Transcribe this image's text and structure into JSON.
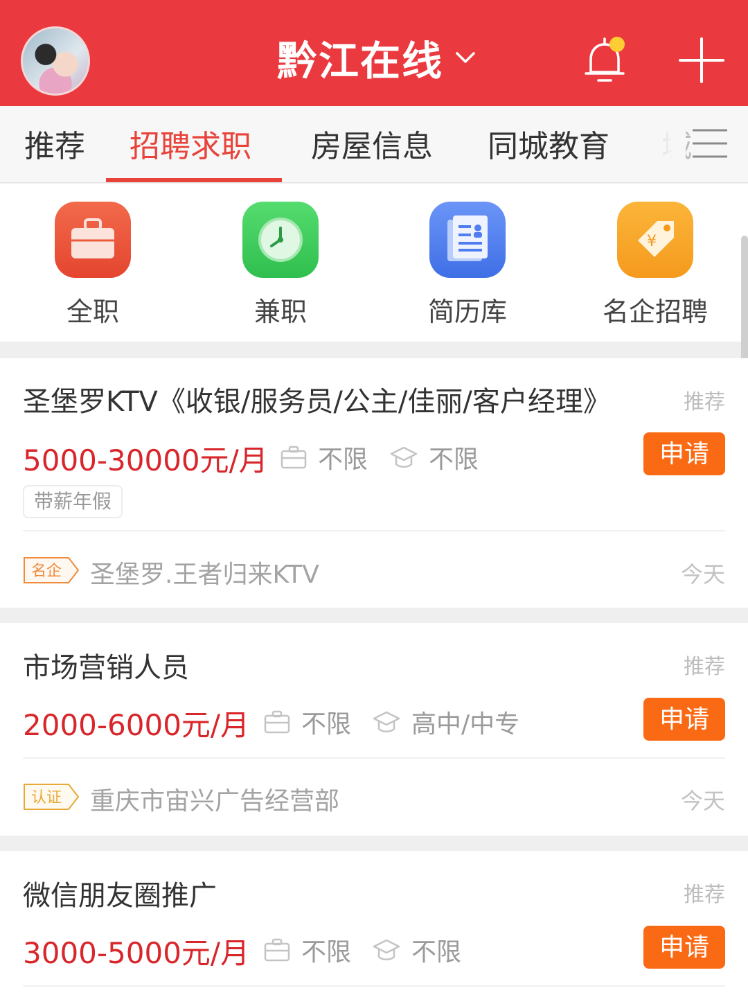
{
  "header": {
    "title": "黔江在线",
    "title_icon": "chevron-down-icon",
    "notification_icon": "bell-icon",
    "add_icon": "plus-icon",
    "colors": {
      "header_bg": "#ea3a3f",
      "notification_dot": "#ffcc33"
    }
  },
  "tabs": {
    "items": [
      {
        "label": "推荐"
      },
      {
        "label": "招聘求职"
      },
      {
        "label": "房屋信息"
      },
      {
        "label": "同城教育"
      },
      {
        "label": "城"
      }
    ],
    "active_index": 1,
    "menu_icon": "menu-icon",
    "colors": {
      "active": "#e8433a"
    }
  },
  "categories": [
    {
      "label": "全职",
      "icon": "briefcase-icon",
      "color": "#ec5a3c"
    },
    {
      "label": "兼职",
      "icon": "clock-icon",
      "color": "#3fcd5b"
    },
    {
      "label": "简历库",
      "icon": "resume-icon",
      "color": "#4f7ef0"
    },
    {
      "label": "名企招聘",
      "icon": "tag-icon",
      "color": "#f9a526"
    }
  ],
  "jobs": [
    {
      "title": "圣堡罗KTV《收银/服务员/公主/佳丽/客户经理》",
      "recommend": "推荐",
      "salary": "5000-30000元/月",
      "experience": "不限",
      "education": "不限",
      "apply": "申请",
      "tags": [
        "带薪年假"
      ],
      "badge": "名企",
      "company": "圣堡罗.王者归来KTV",
      "date": "今天"
    },
    {
      "title": "市场营销人员",
      "recommend": "推荐",
      "salary": "2000-6000元/月",
      "experience": "不限",
      "education": "高中/中专",
      "apply": "申请",
      "tags": [],
      "badge": "认证",
      "company": "重庆市宙兴广告经营部",
      "date": "今天"
    },
    {
      "title": "微信朋友圈推广",
      "recommend": "推荐",
      "salary": "3000-5000元/月",
      "experience": "不限",
      "education": "不限",
      "apply": "申请",
      "tags": []
    }
  ],
  "colors": {
    "salary": "#d8262b",
    "apply_button": "#fa6a14",
    "badge_orange": "#f08a3c",
    "badge_gold": "#e9a93a"
  }
}
